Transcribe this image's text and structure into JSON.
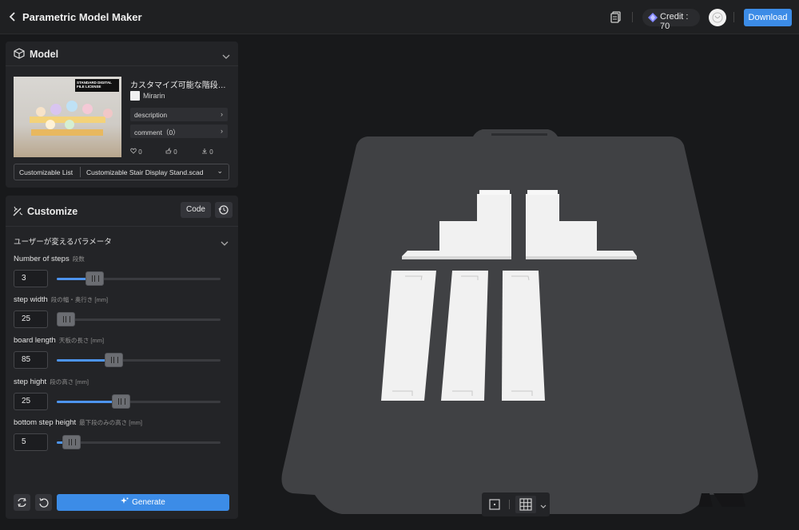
{
  "topbar": {
    "title": "Parametric Model Maker",
    "credit_label": "Credit : 70",
    "download_label": "Download"
  },
  "model_panel": {
    "title": "Model",
    "license_text": "STANDARD DIGITAL FILE LICENSE",
    "model_title": "カスタマイズ可能な階段デ...",
    "author": "Mirarin",
    "description_label": "description",
    "comment_label": "comment（0）",
    "likes": "0",
    "boosts": "0",
    "downloads": "0",
    "customizable_label": "Customizable List",
    "file_name": "Customizable Stair Display Stand.scad"
  },
  "customize_panel": {
    "title": "Customize",
    "code_label": "Code",
    "group_title": "ユーザーが変えるパラメータ",
    "params": [
      {
        "name": "Number of steps",
        "hint": "段数",
        "value": "3",
        "level": 0.2
      },
      {
        "name": "step width",
        "hint": "段の幅・奥行き [mm]",
        "value": "25",
        "level": 0.0
      },
      {
        "name": "board length",
        "hint": "天板の長さ [mm]",
        "value": "85",
        "level": 0.33
      },
      {
        "name": "step hight",
        "hint": "段の高さ [mm]",
        "value": "25",
        "level": 0.38
      },
      {
        "name": "bottom step height",
        "hint": "最下段のみの高さ [mm]",
        "value": "5",
        "level": 0.04
      }
    ],
    "generate_label": "Generate"
  },
  "icons": [
    "back-arrow-icon",
    "document-icon",
    "gem-icon",
    "avatar",
    "cube-icon",
    "chevron-down-icon",
    "wand-icon",
    "history-icon",
    "sync-icon",
    "undo-icon",
    "sparkle-icon",
    "frame-icon",
    "grid-icon"
  ],
  "colors": {
    "accent": "#3c8ce7",
    "panel": "#232427",
    "background": "#18191b",
    "build_plate": "#3f4043",
    "model_parts": "#f2f2f2"
  }
}
